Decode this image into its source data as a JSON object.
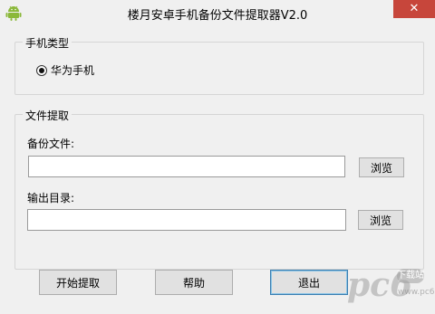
{
  "window": {
    "title": "楼月安卓手机备份文件提取器V2.0",
    "close_glyph": "✕",
    "app_icon": "android-icon"
  },
  "phone_type_group": {
    "legend": "手机类型",
    "radio_label": "华为手机",
    "selected": true
  },
  "extract_group": {
    "legend": "文件提取",
    "backup_file_label": "备份文件:",
    "backup_file_value": "",
    "browse1_label": "浏览",
    "output_dir_label": "输出目录:",
    "output_dir_value": "",
    "browse2_label": "浏览"
  },
  "buttons": {
    "start_label": "开始提取",
    "help_label": "帮助",
    "exit_label": "退出"
  },
  "watermark": {
    "text": "pc6",
    "badge": "下载站",
    "url": "www.pc6.com"
  },
  "colors": {
    "close_red": "#c7463b",
    "android_green": "#8bb83a",
    "default_button_border": "#3c7fb1"
  }
}
